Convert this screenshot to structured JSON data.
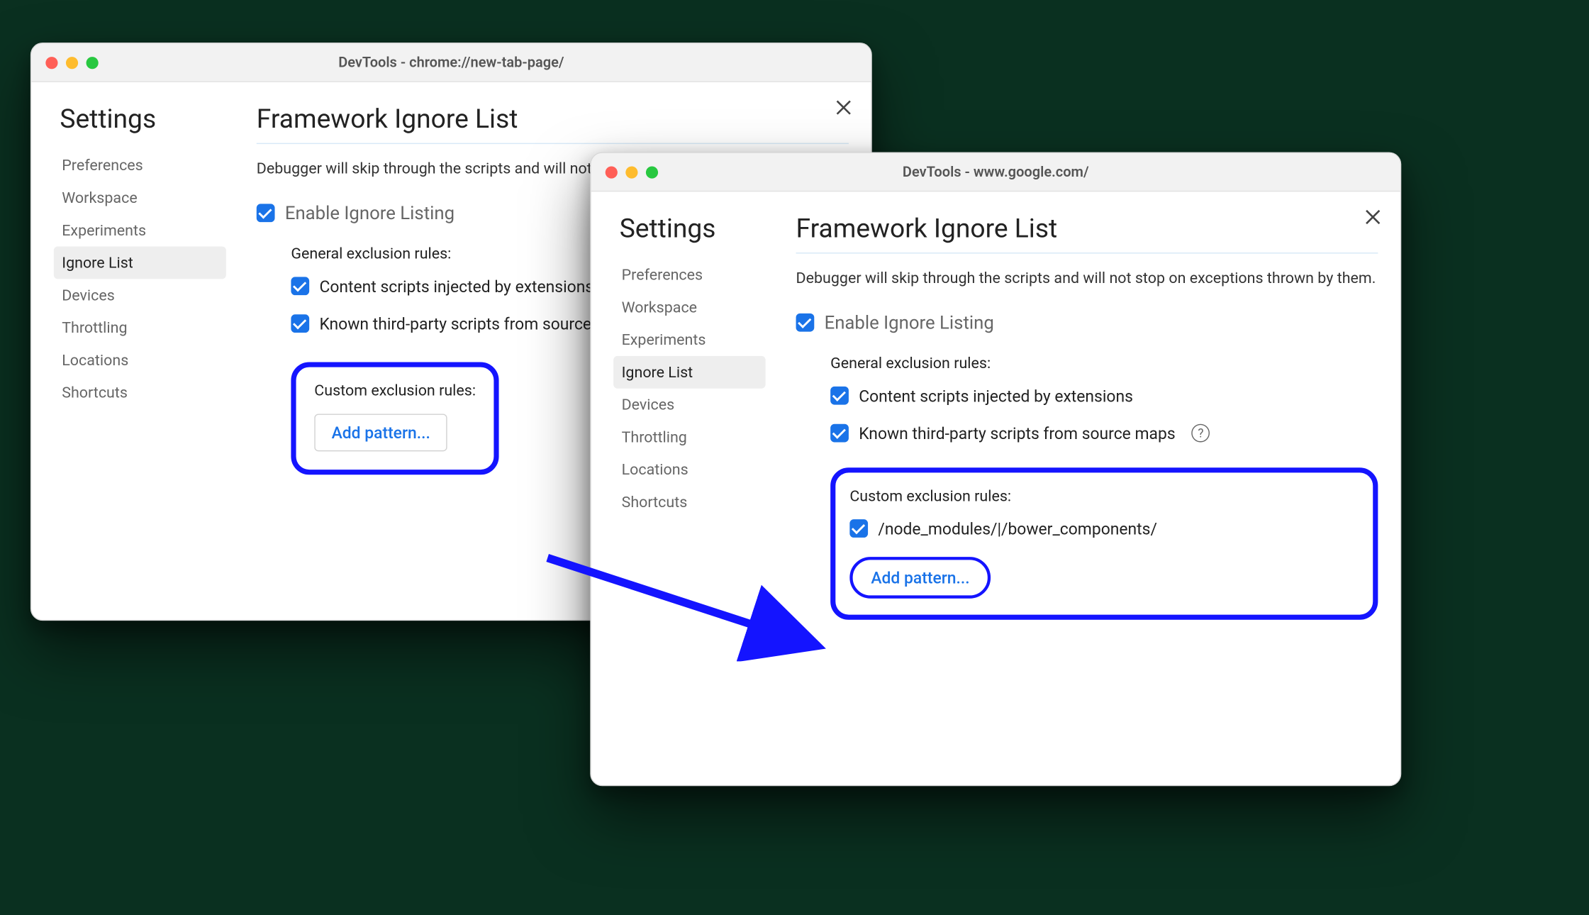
{
  "window1": {
    "title": "DevTools - chrome://new-tab-page/",
    "sidebar": {
      "title": "Settings",
      "items": [
        "Preferences",
        "Workspace",
        "Experiments",
        "Ignore List",
        "Devices",
        "Throttling",
        "Locations",
        "Shortcuts"
      ],
      "activeIndex": 3
    },
    "main": {
      "title": "Framework Ignore List",
      "description": "Debugger will skip through the scripts and will not stop on exceptions thrown by them.",
      "enableLabel": "Enable Ignore Listing",
      "generalRulesLabel": "General exclusion rules:",
      "rule1": "Content scripts injected by extensions",
      "rule2": "Known third-party scripts from source maps",
      "customRulesLabel": "Custom exclusion rules:",
      "addPatternLabel": "Add pattern..."
    }
  },
  "window2": {
    "title": "DevTools - www.google.com/",
    "sidebar": {
      "title": "Settings",
      "items": [
        "Preferences",
        "Workspace",
        "Experiments",
        "Ignore List",
        "Devices",
        "Throttling",
        "Locations",
        "Shortcuts"
      ],
      "activeIndex": 3
    },
    "main": {
      "title": "Framework Ignore List",
      "description": "Debugger will skip through the scripts and will not stop on exceptions thrown by them.",
      "enableLabel": "Enable Ignore Listing",
      "generalRulesLabel": "General exclusion rules:",
      "rule1": "Content scripts injected by extensions",
      "rule2": "Known third-party scripts from source maps",
      "customRulesLabel": "Custom exclusion rules:",
      "customPattern": "/node_modules/|/bower_components/",
      "addPatternLabel": "Add pattern..."
    }
  }
}
